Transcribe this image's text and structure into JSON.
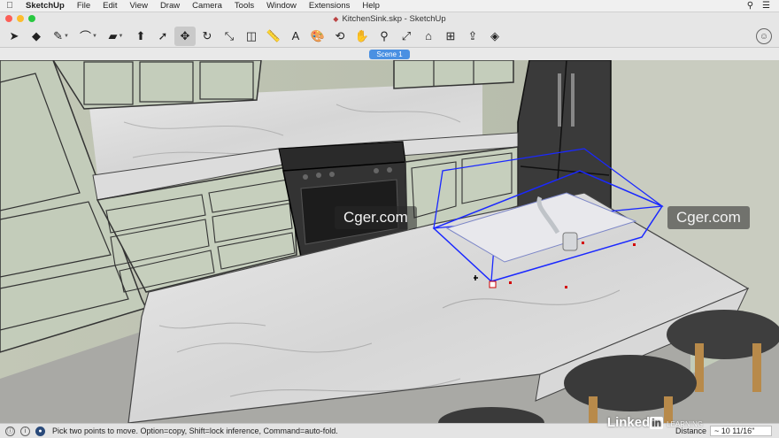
{
  "menubar": {
    "app": "SketchUp",
    "items": [
      "File",
      "Edit",
      "View",
      "Draw",
      "Camera",
      "Tools",
      "Window",
      "Extensions",
      "Help"
    ]
  },
  "window": {
    "title": "KitchenSink.skp - SketchUp"
  },
  "toolbar": {
    "tools": [
      {
        "name": "select-tool",
        "glyph": "➤",
        "icon": "cursor-arrow-icon"
      },
      {
        "name": "eraser-tool",
        "glyph": "◆",
        "icon": "eraser-icon"
      },
      {
        "name": "line-tool",
        "glyph": "✎",
        "icon": "pencil-icon",
        "dropdown": true
      },
      {
        "name": "arc-tool",
        "glyph": "⌒",
        "icon": "arc-icon",
        "dropdown": true
      },
      {
        "name": "shapes-tool",
        "glyph": "▰",
        "icon": "rectangle-icon",
        "dropdown": true
      },
      {
        "name": "push-pull-tool",
        "glyph": "⬆",
        "icon": "push-pull-icon"
      },
      {
        "name": "follow-me-tool",
        "glyph": "➚",
        "icon": "follow-me-icon"
      },
      {
        "name": "move-tool",
        "glyph": "✥",
        "icon": "move-arrows-icon",
        "active": true
      },
      {
        "name": "rotate-tool",
        "glyph": "↻",
        "icon": "rotate-icon"
      },
      {
        "name": "scale-tool",
        "glyph": "⤡",
        "icon": "scale-icon"
      },
      {
        "name": "offset-tool",
        "glyph": "◫",
        "icon": "offset-icon"
      },
      {
        "name": "tape-measure-tool",
        "glyph": "📏",
        "icon": "tape-measure-icon"
      },
      {
        "name": "text-tool",
        "glyph": "A",
        "icon": "text-icon"
      },
      {
        "name": "paint-bucket-tool",
        "glyph": "🎨",
        "icon": "paint-bucket-icon"
      },
      {
        "name": "orbit-tool",
        "glyph": "⟲",
        "icon": "orbit-icon"
      },
      {
        "name": "pan-tool",
        "glyph": "✋",
        "icon": "hand-icon"
      },
      {
        "name": "zoom-tool",
        "glyph": "⚲",
        "icon": "magnifier-icon"
      },
      {
        "name": "zoom-extents-tool",
        "glyph": "⤢",
        "icon": "zoom-extents-icon"
      },
      {
        "name": "warehouse-tool",
        "glyph": "⌂",
        "icon": "3d-warehouse-icon"
      },
      {
        "name": "extension-warehouse-tool",
        "glyph": "⊞",
        "icon": "extension-warehouse-icon"
      },
      {
        "name": "send-to-layout-tool",
        "glyph": "⇪",
        "icon": "layout-icon"
      },
      {
        "name": "ruby-console-tool",
        "glyph": "◈",
        "icon": "ruby-icon"
      }
    ]
  },
  "scenes": {
    "tabs": [
      "Scene 1"
    ]
  },
  "watermarks": [
    "Cger.com",
    "Cger.com"
  ],
  "statusbar": {
    "message": "Pick two points to move.  Option=copy, Shift=lock inference, Command=auto-fold.",
    "measure_label": "Distance",
    "measure_value": "~ 10 11/16\"",
    "brand": "Linked",
    "brand_in": "in",
    "brand_learning": "LEARNING"
  }
}
